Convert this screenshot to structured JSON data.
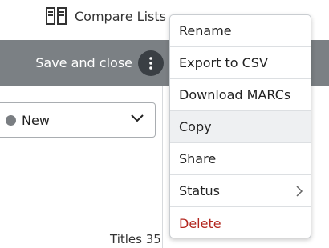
{
  "header": {
    "compare_label": "Compare Lists",
    "compare_icon": "compare-columns-icon"
  },
  "actionbar": {
    "save_close_label": "Save and close",
    "more_icon": "vertical-ellipsis-icon"
  },
  "panel": {
    "status_value": "New",
    "status_dot_color": "#7a7e82",
    "titles_label": "Titles 35"
  },
  "menu": {
    "items": [
      {
        "label": "Rename"
      },
      {
        "label": "Export to CSV"
      },
      {
        "label": "Download MARCs"
      },
      {
        "label": "Copy",
        "state": "hovered"
      },
      {
        "label": "Share"
      },
      {
        "label": "Status",
        "has_submenu": true
      },
      {
        "label": "Delete",
        "style": "danger"
      }
    ]
  },
  "colors": {
    "actionbar_bg": "#7b8084",
    "kebab_bg": "#3a3f44",
    "delete_text": "#b3261e",
    "hover_bg": "#eef0f2"
  }
}
